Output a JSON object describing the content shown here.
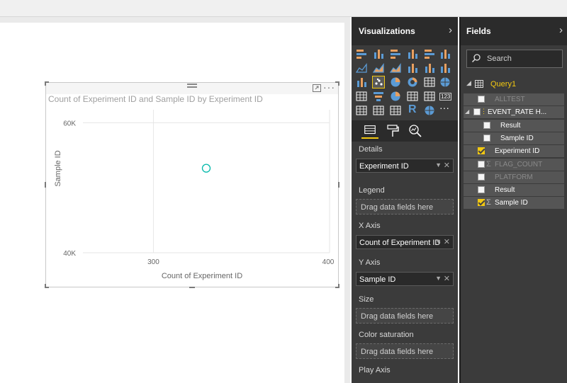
{
  "chart_data": {
    "type": "scatter",
    "title": "Count of Experiment ID and Sample ID by Experiment ID",
    "xlabel": "Count of Experiment ID",
    "ylabel": "Sample ID",
    "x_ticks": [
      "300",
      "400"
    ],
    "y_ticks": [
      "60K",
      "40K"
    ],
    "xlim": [
      260,
      400
    ],
    "ylim": [
      40000,
      62000
    ],
    "points": [
      {
        "x": 330,
        "y": 53000
      }
    ],
    "grid": true,
    "marker_color": "#01b8aa"
  },
  "visualizations": {
    "title": "Visualizations",
    "wells": {
      "details": {
        "label": "Details",
        "field": "Experiment ID"
      },
      "legend": {
        "label": "Legend",
        "placeholder": "Drag data fields here"
      },
      "x_axis": {
        "label": "X Axis",
        "field": "Count of Experiment ID"
      },
      "y_axis": {
        "label": "Y Axis",
        "field": "Sample ID"
      },
      "size": {
        "label": "Size",
        "placeholder": "Drag data fields here"
      },
      "color_saturation": {
        "label": "Color saturation",
        "placeholder": "Drag data fields here"
      },
      "play_axis": {
        "label": "Play Axis"
      }
    },
    "gallery_more": "···",
    "r_icon": "R",
    "kpi_icon": "123"
  },
  "fields": {
    "title": "Fields",
    "search_placeholder": "Search",
    "table_name": "Query1",
    "items": [
      {
        "label": "ALLTEST",
        "checked": false,
        "sigma": false,
        "dim": true
      },
      {
        "label": "EVENT_RATE H...",
        "checked": false,
        "sigma": false,
        "dim": false,
        "hierarchy": true
      },
      {
        "label": "Result",
        "checked": false,
        "sigma": false,
        "dim": false,
        "child": true
      },
      {
        "label": "Sample ID",
        "checked": false,
        "sigma": false,
        "dim": false,
        "child": true
      },
      {
        "label": "Experiment ID",
        "checked": true,
        "sigma": false,
        "dim": false
      },
      {
        "label": "FLAG_COUNT",
        "checked": false,
        "sigma": true,
        "dim": true
      },
      {
        "label": "PLATFORM",
        "checked": false,
        "sigma": false,
        "dim": true
      },
      {
        "label": "Result",
        "checked": false,
        "sigma": false,
        "dim": false
      },
      {
        "label": "Sample ID",
        "checked": true,
        "sigma": true,
        "dim": false
      }
    ]
  },
  "visual": {
    "more": "···"
  },
  "colors": {
    "accent": "#f2c811",
    "pane_bg": "#3b3b3b",
    "header_bg": "#2b2b2b"
  }
}
